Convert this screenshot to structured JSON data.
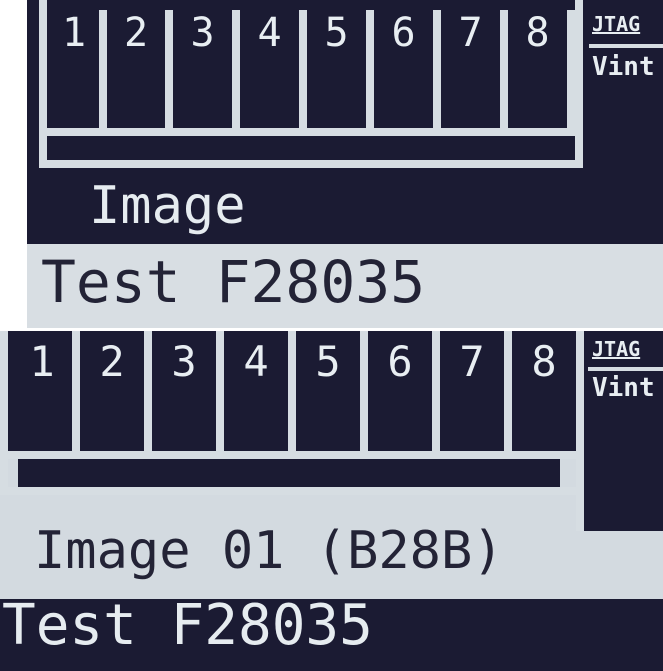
{
  "slots": [
    "1",
    "2",
    "3",
    "4",
    "5",
    "6",
    "7",
    "8"
  ],
  "indicator_top": "JTAG",
  "indicator_bottom": "Vint",
  "screens": [
    {
      "image_line": "Image",
      "test_line": "Test F28035"
    },
    {
      "image_line": "Image 01 (B28B)",
      "test_line": "Test F28035"
    }
  ],
  "colors": {
    "lcd_dark": "#1b1b33",
    "lcd_light": "#d6dde2"
  }
}
